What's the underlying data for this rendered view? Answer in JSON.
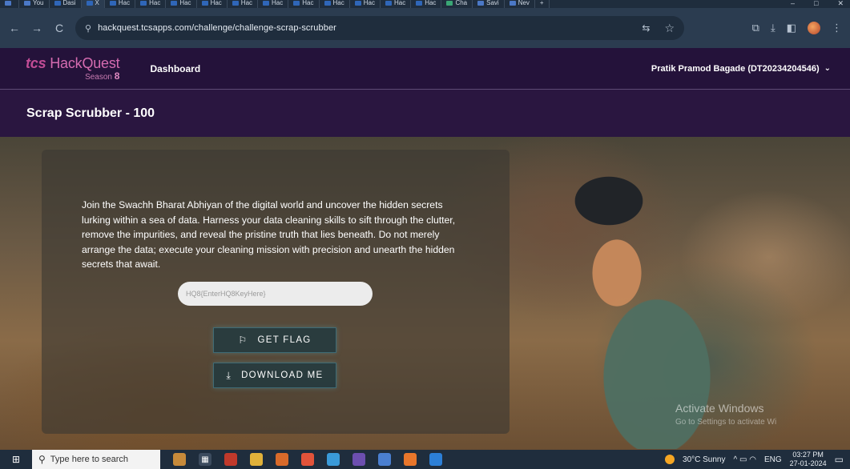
{
  "browser": {
    "tabs": [
      {
        "label": "",
        "favicon": "generic"
      },
      {
        "label": "You",
        "favicon": "generic"
      },
      {
        "label": "Dasi",
        "favicon": "tata"
      },
      {
        "label": "X",
        "favicon": "tata",
        "active": true
      },
      {
        "label": "Hac",
        "favicon": "tata"
      },
      {
        "label": "Hac",
        "favicon": "tata"
      },
      {
        "label": "Hac",
        "favicon": "tata"
      },
      {
        "label": "Hac",
        "favicon": "tata"
      },
      {
        "label": "Hac",
        "favicon": "tata"
      },
      {
        "label": "Hac",
        "favicon": "tata"
      },
      {
        "label": "Hac",
        "favicon": "tata"
      },
      {
        "label": "Hac",
        "favicon": "tata"
      },
      {
        "label": "Hac",
        "favicon": "tata"
      },
      {
        "label": "Hac",
        "favicon": "tata"
      },
      {
        "label": "Hac",
        "favicon": "tata"
      },
      {
        "label": "Cha",
        "favicon": "green"
      },
      {
        "label": "Savi",
        "favicon": "generic"
      },
      {
        "label": "Nev",
        "favicon": "generic"
      },
      {
        "label": "+",
        "favicon": "none"
      }
    ],
    "url": "hackquest.tcsapps.com/challenge/challenge-scrap-scrubber",
    "window_controls": {
      "minimize": "–",
      "maximize": "□",
      "close": "✕"
    },
    "icons": {
      "back": "←",
      "forward": "→",
      "reload": "C",
      "site_info": "⚲",
      "translate": "⇆",
      "bookmark": "☆",
      "extensions": "⧉",
      "download": "⤓",
      "sidepanel": "◧",
      "menu": "⋮"
    }
  },
  "site": {
    "logo_brand": "tcs",
    "logo_name": "HackQuest",
    "logo_season_prefix": "Season",
    "logo_season_number": "8",
    "nav_dashboard": "Dashboard",
    "user_name": "Pratik Pramod Bagade (DT20234204546)",
    "user_chevron": "⌄"
  },
  "challenge": {
    "title": "Scrap Scrubber - 100",
    "description": "Join the Swachh Bharat Abhiyan of the digital world and uncover the hidden secrets lurking within a sea of data. Harness your data cleaning skills to sift through the clutter, remove the impurities, and reveal the pristine truth that lies beneath. Do not merely arrange the data; execute your cleaning mission with precision and unearth the hidden secrets that await.",
    "flag_placeholder": "HQ8{EnterHQ8KeyHere}",
    "get_flag_label": "GET FLAG",
    "download_label": "DOWNLOAD ME",
    "get_flag_icon": "⚐",
    "download_icon": "⤓"
  },
  "watermark": {
    "line1": "Activate Windows",
    "line2": "Go to Settings to activate Wi"
  },
  "taskbar": {
    "search_placeholder": "Type here to search",
    "weather": "30°C  Sunny",
    "language": "ENG",
    "time": "03:27 PM",
    "date": "27-01-2024",
    "tray_icons": "^ ▭ ◠"
  },
  "colors": {
    "site_header": "#24123a",
    "title_bar": "#2a1640",
    "accent_button_border": "#3f6b75",
    "logo_pink": "#d56bb0"
  }
}
